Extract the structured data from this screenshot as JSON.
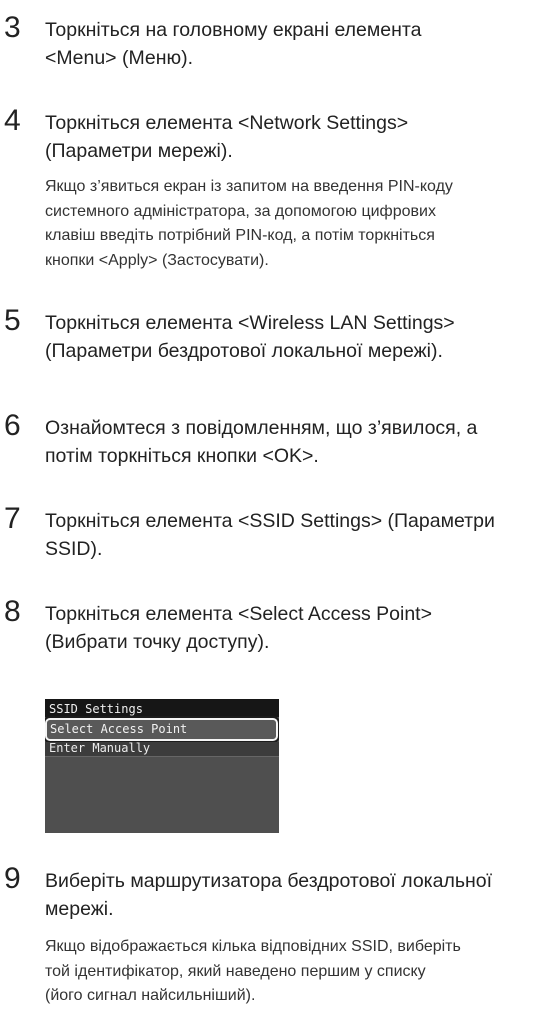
{
  "steps": [
    {
      "num": "3",
      "lines": [
        "Торкніться на головному екрані елемента",
        "<Menu> (Меню)."
      ]
    },
    {
      "num": "4",
      "lines": [
        "Торкніться елемента <Network Settings>",
        "(Параметри мережі)."
      ],
      "note": [
        "Якщо з’явиться екран із запитом на введення PIN-коду",
        "системного адміністратора, за допомогою цифрових",
        "клавіш введіть потрібний PIN-код, а потім торкніться",
        "кнопки <Apply> (Застосувати)."
      ]
    },
    {
      "num": "5",
      "lines": [
        "Торкніться елемента <Wireless LAN Settings>",
        "(Параметри бездротової локальної мережі)."
      ]
    },
    {
      "num": "6",
      "lines": [
        "Ознайомтеся з повідомленням, що з’явилося, а",
        "потім торкніться кнопки <OK>."
      ]
    },
    {
      "num": "7",
      "lines": [
        "Торкніться елемента <SSID Settings> (Параметри",
        "SSID)."
      ]
    },
    {
      "num": "8",
      "lines": [
        "Торкніться елемента <Select Access Point>",
        "(Вибрати точку доступу)."
      ]
    },
    {
      "num": "9",
      "lines": [
        "Виберіть маршрутизатора бездротової локальної",
        "мережі."
      ],
      "note": [
        "Якщо відображається кілька відповідних SSID, виберіть",
        "той ідентифікатор, який наведено першим у списку",
        "(його сигнал найсильніший)."
      ]
    }
  ],
  "screen": {
    "title": "SSID Settings",
    "items": [
      "Select Access Point",
      "Enter Manually"
    ]
  }
}
